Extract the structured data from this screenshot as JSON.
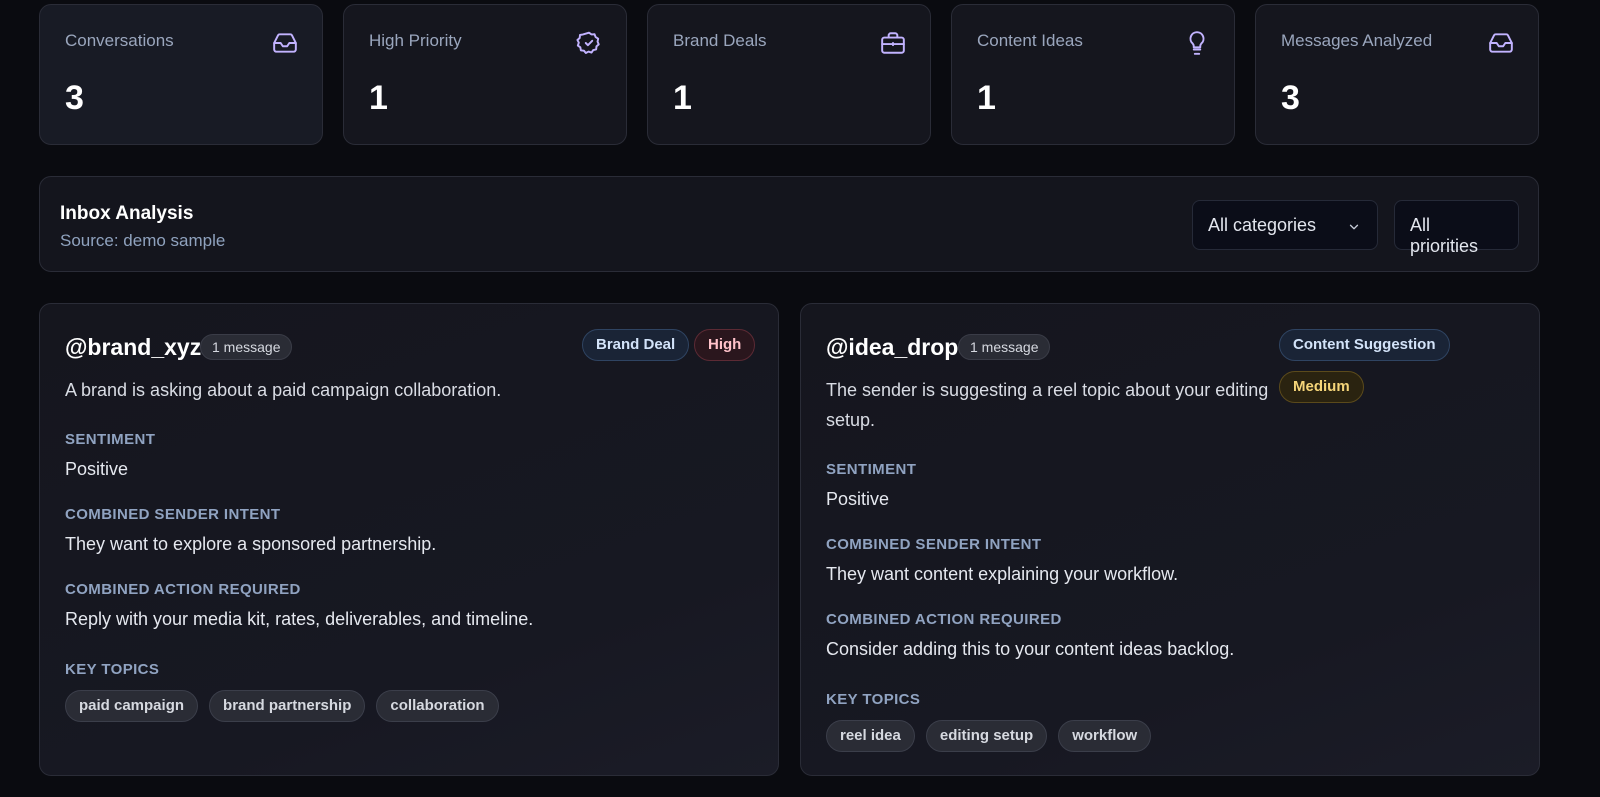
{
  "stats": [
    {
      "label": "Conversations",
      "value": "3",
      "icon": "inbox-icon"
    },
    {
      "label": "High Priority",
      "value": "1",
      "icon": "badge-check-icon"
    },
    {
      "label": "Brand Deals",
      "value": "1",
      "icon": "briefcase-icon"
    },
    {
      "label": "Content Ideas",
      "value": "1",
      "icon": "lightbulb-icon"
    },
    {
      "label": "Messages Analyzed",
      "value": "3",
      "icon": "inbox-icon"
    }
  ],
  "analysis": {
    "title": "Inbox Analysis",
    "source": "Source: demo sample",
    "category_filter": "All categories",
    "priority_filter": "All priorities"
  },
  "conversations": [
    {
      "handle": "@brand_xyz",
      "message_count": "1 message",
      "category": "Brand Deal",
      "priority": "High",
      "summary": "A brand is asking about a paid campaign collaboration.",
      "sentiment_label": "SENTIMENT",
      "sentiment": "Positive",
      "intent_label": "COMBINED SENDER INTENT",
      "intent": "They want to explore a sponsored partnership.",
      "action_label": "COMBINED ACTION REQUIRED",
      "action": "Reply with your media kit, rates, deliverables, and timeline.",
      "topics_label": "KEY TOPICS",
      "topics": [
        "paid campaign",
        "brand partnership",
        "collaboration"
      ]
    },
    {
      "handle": "@idea_drop",
      "message_count": "1 message",
      "category": "Content Suggestion",
      "priority": "Medium",
      "summary_line1": "The sender is suggesting a reel topic about your editing",
      "summary_line2": "setup.",
      "sentiment_label": "SENTIMENT",
      "sentiment": "Positive",
      "intent_label": "COMBINED SENDER INTENT",
      "intent": "They want content explaining your workflow.",
      "action_label": "COMBINED ACTION REQUIRED",
      "action": "Consider adding this to your content ideas backlog.",
      "topics_label": "KEY TOPICS",
      "topics": [
        "reel idea",
        "editing setup",
        "workflow"
      ]
    }
  ]
}
